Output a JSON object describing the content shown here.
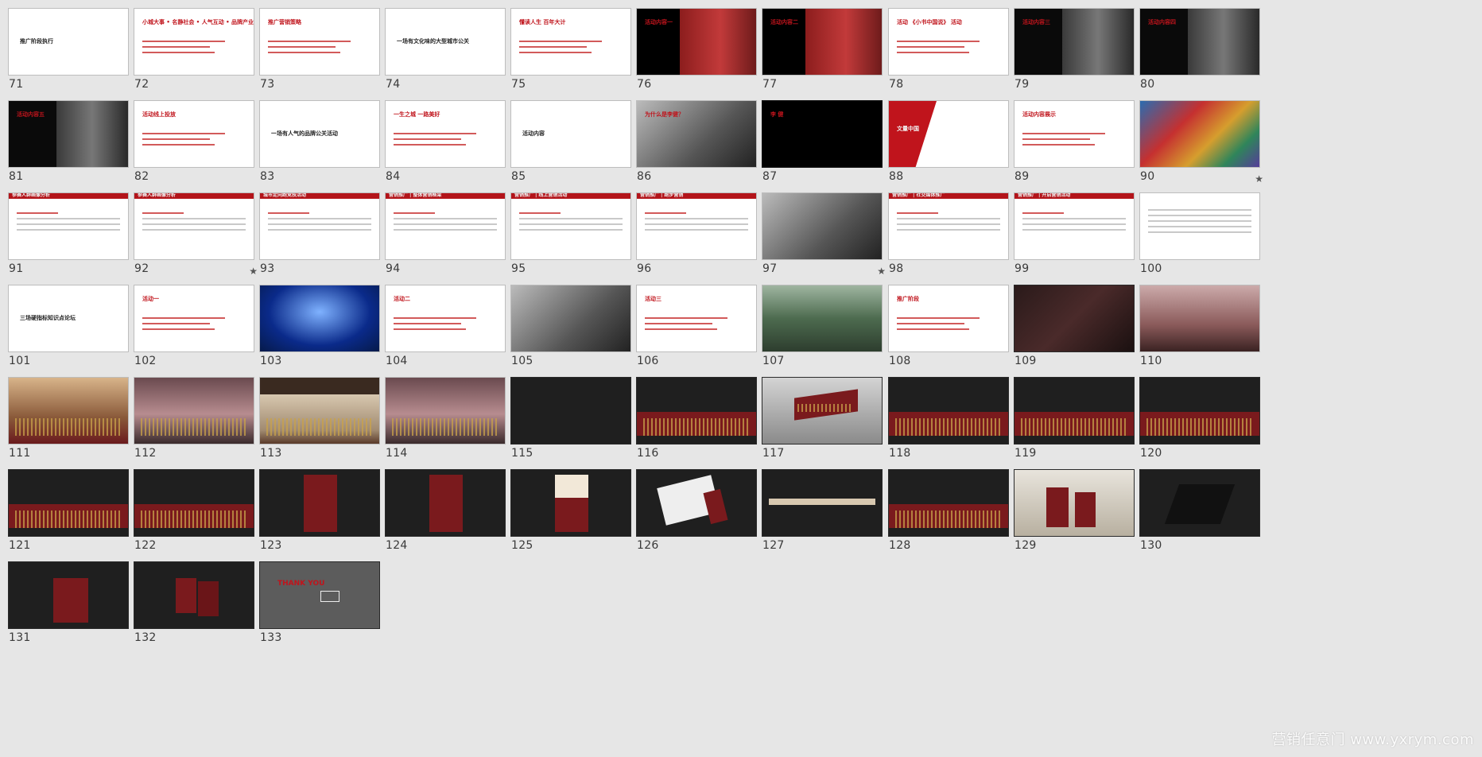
{
  "slides": [
    {
      "n": "71",
      "style": "white",
      "title": "推广阶段执行",
      "tc": "dark"
    },
    {
      "n": "72",
      "style": "white",
      "title": "小城大事 • 名静社会 • 人气互动 • 品牌产业",
      "tc": "red"
    },
    {
      "n": "73",
      "style": "white",
      "title": "推广营销策略",
      "tc": "red"
    },
    {
      "n": "74",
      "style": "white",
      "title": "一场有文化味的大型城市公关",
      "tc": "dark"
    },
    {
      "n": "75",
      "style": "white",
      "title": "懂读人生 百年大计",
      "tc": "red"
    },
    {
      "n": "76",
      "style": "photo-red",
      "title": "活动内容一",
      "tc": "red"
    },
    {
      "n": "77",
      "style": "photo-red",
      "title": "活动内容二",
      "tc": "red"
    },
    {
      "n": "78",
      "style": "white",
      "title": "活动 《小书中国说》 活动",
      "tc": "red"
    },
    {
      "n": "79",
      "style": "photo-dark",
      "title": "活动内容三",
      "tc": "red"
    },
    {
      "n": "80",
      "style": "photo-dark",
      "title": "活动内容四",
      "tc": "red"
    },
    {
      "n": "81",
      "style": "photo-dark",
      "title": "活动内容五",
      "tc": "red"
    },
    {
      "n": "82",
      "style": "white",
      "title": "活动线上投放",
      "tc": "red"
    },
    {
      "n": "83",
      "style": "white",
      "title": "一场有人气的品牌公关活动",
      "tc": "dark"
    },
    {
      "n": "84",
      "style": "white",
      "title": "一生之城 一路美好",
      "tc": "red"
    },
    {
      "n": "85",
      "style": "white",
      "title": "活动内容",
      "tc": "dark"
    },
    {
      "n": "86",
      "style": "photo-grey",
      "title": "为什么是李健？",
      "tc": "red"
    },
    {
      "n": "87",
      "style": "black",
      "title": "李 健",
      "tc": "red"
    },
    {
      "n": "88",
      "style": "white-red",
      "title": "文量中国",
      "tc": "white"
    },
    {
      "n": "89",
      "style": "white",
      "title": "活动内容展示",
      "tc": "red"
    },
    {
      "n": "90",
      "style": "photo-color",
      "title": "",
      "tc": "dark",
      "star": "★"
    },
    {
      "n": "91",
      "style": "white-bar",
      "title": "参赛人群画像分析",
      "tc": "white"
    },
    {
      "n": "92",
      "style": "white-bar",
      "title": "参赛人群画像分析",
      "tc": "white",
      "star": "★"
    },
    {
      "n": "93",
      "style": "white-bar",
      "title": "城市定向跑竞技活动",
      "tc": "white"
    },
    {
      "n": "94",
      "style": "white-bar",
      "title": "营销推广 | 整体营销框架",
      "tc": "white"
    },
    {
      "n": "95",
      "style": "white-bar",
      "title": "营销推广 | 线上营销活动",
      "tc": "white"
    },
    {
      "n": "96",
      "style": "white-bar",
      "title": "营销推广 | 跑步营销",
      "tc": "white"
    },
    {
      "n": "97",
      "style": "photo-grey",
      "title": "",
      "tc": "white",
      "star": "★"
    },
    {
      "n": "98",
      "style": "white-bar",
      "title": "营销推广 | 社交媒体推广",
      "tc": "white"
    },
    {
      "n": "99",
      "style": "white-bar",
      "title": "营销推广 | 开启营销活动",
      "tc": "white"
    },
    {
      "n": "100",
      "style": "white",
      "title": "",
      "tc": "dark"
    },
    {
      "n": "101",
      "style": "white",
      "title": "三场硬指标知识点论坛",
      "tc": "dark"
    },
    {
      "n": "102",
      "style": "white",
      "title": "活动一",
      "tc": "red"
    },
    {
      "n": "103",
      "style": "photo-blue",
      "title": "",
      "tc": "white"
    },
    {
      "n": "104",
      "style": "white",
      "title": "活动二",
      "tc": "red"
    },
    {
      "n": "105",
      "style": "photo-grey",
      "title": "",
      "tc": "white"
    },
    {
      "n": "106",
      "style": "white",
      "title": "活动三",
      "tc": "red"
    },
    {
      "n": "107",
      "style": "photo-green",
      "title": "",
      "tc": "white"
    },
    {
      "n": "108",
      "style": "white",
      "title": "推广阶段",
      "tc": "red"
    },
    {
      "n": "109",
      "style": "dark-brown",
      "title": "",
      "tc": "white"
    },
    {
      "n": "110",
      "style": "photo-pink",
      "title": "",
      "tc": "white"
    },
    {
      "n": "111",
      "style": "gold",
      "title": "",
      "tc": "white"
    },
    {
      "n": "112",
      "style": "mauve",
      "title": "",
      "tc": "white"
    },
    {
      "n": "113",
      "style": "sepia",
      "title": "",
      "tc": "white"
    },
    {
      "n": "114",
      "style": "mauve",
      "title": "",
      "tc": "white"
    },
    {
      "n": "115",
      "style": "dark",
      "title": "",
      "tc": "white"
    },
    {
      "n": "116",
      "style": "dark-band",
      "title": "",
      "tc": "white"
    },
    {
      "n": "117",
      "style": "billboard",
      "title": "",
      "tc": "white"
    },
    {
      "n": "118",
      "style": "dark-band",
      "title": "",
      "tc": "white"
    },
    {
      "n": "119",
      "style": "dark-band",
      "title": "",
      "tc": "white"
    },
    {
      "n": "120",
      "style": "dark-band",
      "title": "",
      "tc": "white"
    },
    {
      "n": "121",
      "style": "dark-band",
      "title": "",
      "tc": "white"
    },
    {
      "n": "122",
      "style": "dark-band",
      "title": "",
      "tc": "white"
    },
    {
      "n": "123",
      "style": "dark-poster",
      "title": "",
      "tc": "white"
    },
    {
      "n": "124",
      "style": "dark-poster",
      "title": "",
      "tc": "white"
    },
    {
      "n": "125",
      "style": "dark-poster-light",
      "title": "",
      "tc": "white"
    },
    {
      "n": "126",
      "style": "dark-device",
      "title": "",
      "tc": "white"
    },
    {
      "n": "127",
      "style": "dark-strip",
      "title": "",
      "tc": "white"
    },
    {
      "n": "128",
      "style": "dark-band",
      "title": "",
      "tc": "white"
    },
    {
      "n": "129",
      "style": "cups",
      "title": "",
      "tc": "white"
    },
    {
      "n": "130",
      "style": "dark-box",
      "title": "",
      "tc": "white"
    },
    {
      "n": "131",
      "style": "dark-bag",
      "title": "",
      "tc": "white"
    },
    {
      "n": "132",
      "style": "dark-cards",
      "title": "",
      "tc": "white"
    },
    {
      "n": "133",
      "style": "thanks",
      "title": "THANK YOU",
      "tc": "red"
    }
  ],
  "watermark": "营销任意门 www.yxrym.com",
  "colors": {
    "accent": "#b3141a",
    "background": "#e6e6e6"
  }
}
